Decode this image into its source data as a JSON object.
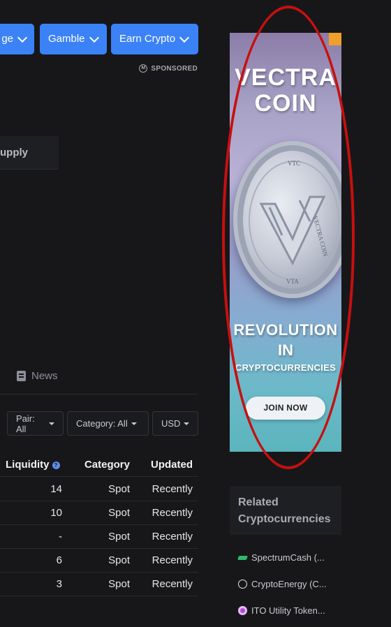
{
  "nav": {
    "items": [
      {
        "label": "ge"
      },
      {
        "label": "Gamble"
      },
      {
        "label": "Earn Crypto"
      }
    ]
  },
  "sponsored": {
    "label": "SPONSORED"
  },
  "supply_header": {
    "label": "upply"
  },
  "tabs": {
    "news_label": "News"
  },
  "filters": {
    "pair": "Pair: All",
    "category": "Category: All",
    "currency": "USD"
  },
  "table": {
    "columns": {
      "liquidity": "Liquidity",
      "category": "Category",
      "updated": "Updated"
    },
    "rows": [
      {
        "liquidity": "14",
        "category": "Spot",
        "updated": "Recently"
      },
      {
        "liquidity": "10",
        "category": "Spot",
        "updated": "Recently"
      },
      {
        "liquidity": "-",
        "category": "Spot",
        "updated": "Recently"
      },
      {
        "liquidity": "6",
        "category": "Spot",
        "updated": "Recently"
      },
      {
        "liquidity": "3",
        "category": "Spot",
        "updated": "Recently"
      }
    ]
  },
  "ad": {
    "title_line1": "VECTRA",
    "title_line2": "COIN",
    "coin_top_text": "VTC",
    "coin_side_text": "VECTRA COIN",
    "coin_bottom_text": "VTA",
    "tagline1": "REVOLUTION",
    "tagline2": "IN",
    "tagline3": "CRYPTOCURRENCIES",
    "cta": "JOIN NOW"
  },
  "related": {
    "heading": "Related Cryptocurrencies",
    "items": [
      {
        "label": "SpectrumCash (...",
        "icon": "spectrumcash-icon",
        "color": "#2fb86a"
      },
      {
        "label": "CryptoEnergy (C...",
        "icon": "cryptoenergy-icon",
        "color": "#e8e8ea"
      },
      {
        "label": "ITO Utility Token...",
        "icon": "ito-icon",
        "color": "#b04ad8"
      }
    ]
  },
  "colors": {
    "accent": "#3b82f6",
    "highlight_oval": "#c80f0f",
    "background": "#17171a"
  }
}
